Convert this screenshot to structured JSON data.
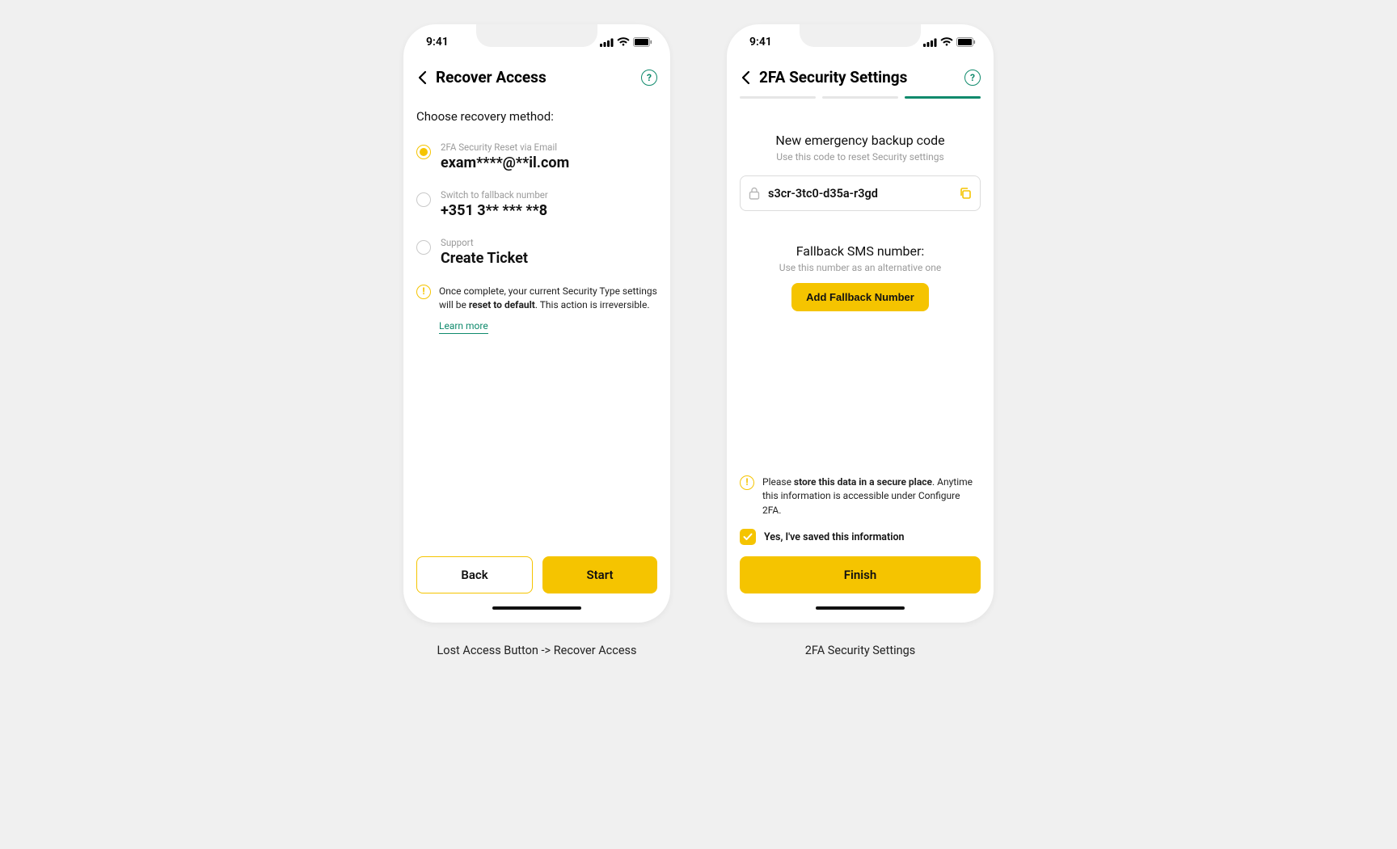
{
  "status": {
    "time": "9:41"
  },
  "screen1": {
    "title": "Recover Access",
    "subtitle": "Choose recovery method:",
    "options": [
      {
        "small": "2FA Security Reset via Email",
        "big": "exam****@**il.com"
      },
      {
        "small": "Switch to fallback number",
        "big": "+351 3** *** **8"
      },
      {
        "small": "Support",
        "big": "Create Ticket"
      }
    ],
    "info_pre": "Once complete, your current Security Type settings will be ",
    "info_bold": "reset to default",
    "info_post": ". This action is irreversible.",
    "learn_more": "Learn more",
    "back": "Back",
    "start": "Start",
    "caption": "Lost Access Button -> Recover Access"
  },
  "screen2": {
    "title": "2FA Security Settings",
    "backup_heading": "New emergency backup code",
    "backup_sub": "Use this code to reset Security settings",
    "backup_code": "s3cr-3tc0-d35a-r3gd",
    "fallback_heading": "Fallback SMS number:",
    "fallback_sub": "Use this number as an alternative one",
    "add_fallback": "Add Fallback Number",
    "info_pre": "Please ",
    "info_bold": "store this data in a secure place",
    "info_post": ". Anytime this information is accessible under Configure 2FA.",
    "saved_label": "Yes, I've saved this information",
    "finish": "Finish",
    "caption": "2FA Security Settings"
  }
}
